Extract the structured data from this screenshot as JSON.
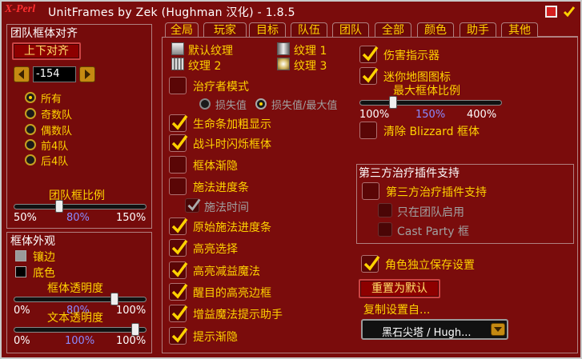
{
  "window": {
    "logo": "X-Perl",
    "title": "UnitFrames by Zek (Hughman 汉化) - 1.8.5"
  },
  "left_panel": {
    "title": "团队框体对齐",
    "align_button": "上下对齐",
    "offset_value": "-154",
    "filters": [
      {
        "label": "所有",
        "selected": true
      },
      {
        "label": "奇数队",
        "selected": false
      },
      {
        "label": "偶数队",
        "selected": false
      },
      {
        "label": "前4队",
        "selected": false
      },
      {
        "label": "后4队",
        "selected": false
      }
    ],
    "scale_caption": "团队框比例",
    "scale_slider": {
      "min": "50%",
      "value": "80%",
      "max": "150%",
      "level": 0.3
    }
  },
  "appearance_panel": {
    "title": "框体外观",
    "border_label": "镶边",
    "bg_label": "底色",
    "border_color": "#9a9a9a",
    "bg_color": "#000000",
    "alpha_caption": "框体透明度",
    "alpha_slider": {
      "min": "0%",
      "value": "80%",
      "max": "100%",
      "level": 0.8
    },
    "text_alpha_caption": "文本透明度",
    "text_alpha_slider": {
      "min": "0%",
      "value": "100%",
      "max": "100%",
      "level": 1.0
    }
  },
  "tabs": [
    {
      "label": "全局",
      "active": true
    },
    {
      "label": "玩家",
      "active": false
    },
    {
      "label": "目标",
      "active": false
    },
    {
      "label": "队伍",
      "active": false
    },
    {
      "label": "团队",
      "active": false
    },
    {
      "label": "全部",
      "active": false
    },
    {
      "label": "颜色",
      "active": false
    },
    {
      "label": "助手",
      "active": false
    },
    {
      "label": "其他",
      "active": false
    }
  ],
  "textures": [
    {
      "label": "默认纹理"
    },
    {
      "label": "纹理 1"
    },
    {
      "label": "纹理 2"
    },
    {
      "label": "纹理 3"
    }
  ],
  "healer": {
    "label": "治疗者模式",
    "checked": false,
    "radio_deficit": "损失值",
    "radio_deficit_max": "损失值/最大值"
  },
  "options": [
    {
      "label": "生命条加粗显示",
      "checked": true
    },
    {
      "label": "战斗时闪烁框体",
      "checked": true
    },
    {
      "label": "框体渐隐",
      "checked": false
    },
    {
      "label": "施法进度条",
      "checked": false
    },
    {
      "label": "施法时间",
      "checked": true
    },
    {
      "label": "原始施法进度条",
      "checked": true
    },
    {
      "label": "高亮选择",
      "checked": true
    },
    {
      "label": "高亮减益魔法",
      "checked": true
    },
    {
      "label": "醒目的高亮边框",
      "checked": true
    },
    {
      "label": "增益魔法提示助手",
      "checked": true
    },
    {
      "label": "提示渐隐",
      "checked": true
    }
  ],
  "right_options": {
    "damage_indicator": {
      "label": "伤害指示器",
      "checked": true
    },
    "minimap_icon": {
      "label": "迷你地图图标",
      "checked": true
    },
    "max_scale_caption": "最大框体比例",
    "max_scale_slider": {
      "min": "100%",
      "value": "150%",
      "max": "400%",
      "level": 0.17
    },
    "clear_blizzard": {
      "label": "清除 Blizzard 框体",
      "checked": false
    }
  },
  "third_party": {
    "title": "第三方治疗插件支持",
    "enable": {
      "label": "第三方治疗插件支持",
      "checked": false
    },
    "raid_only": {
      "label": "只在团队启用",
      "checked": false
    },
    "cast_party": {
      "label": "Cast Party 框",
      "checked": false
    }
  },
  "per_char": {
    "label": "角色独立保存设置",
    "checked": true
  },
  "reset_button": "重置为默认",
  "copy_link": "复制设置自...",
  "profile_dropdown": {
    "value": "黑石尖塔 / Hugh..."
  }
}
